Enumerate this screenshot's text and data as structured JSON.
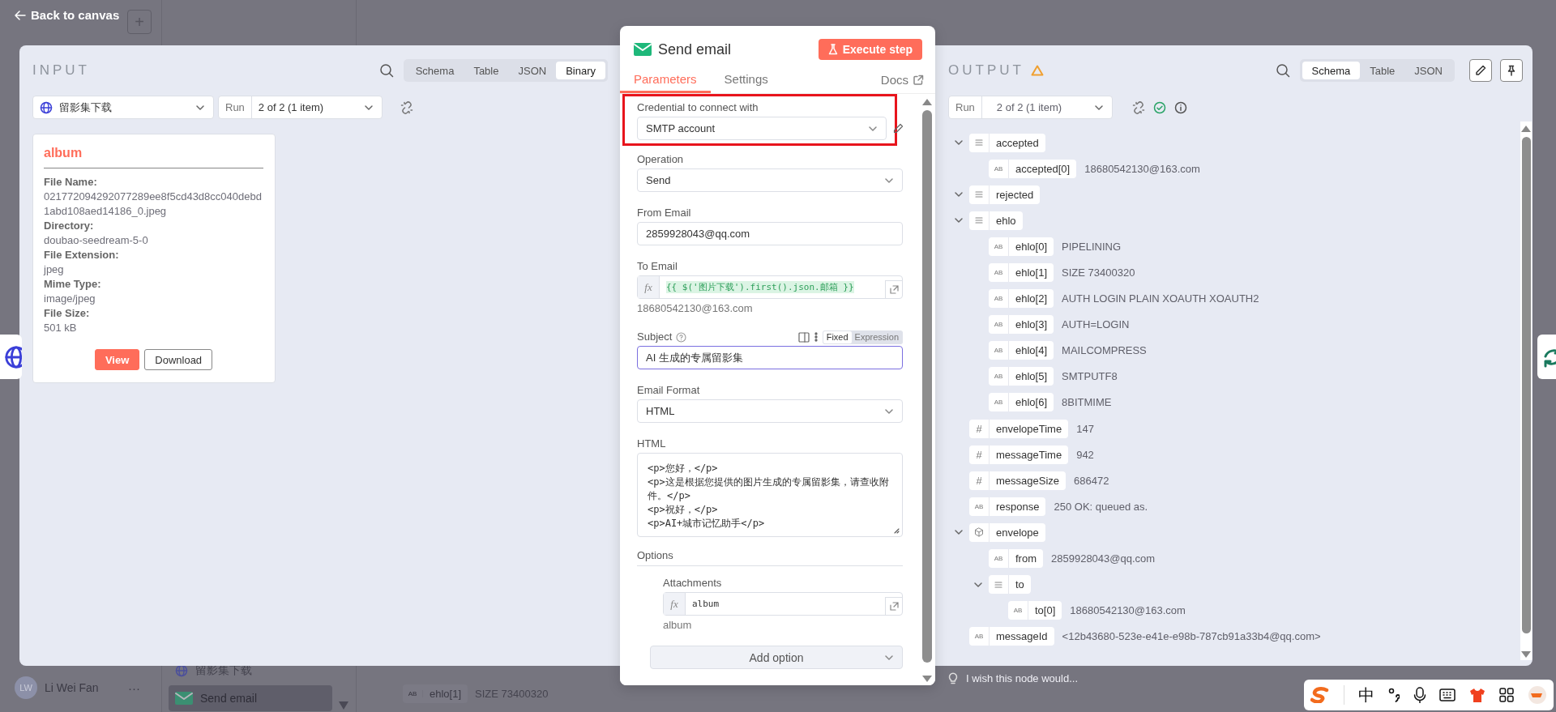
{
  "backdrop": {
    "new_button": "+",
    "user": {
      "initials": "LW",
      "name": "Li Wei Fan",
      "menu": "···"
    },
    "nodes": [
      {
        "label": "留影集下载",
        "kind": "http",
        "selected": false
      },
      {
        "label": "Send email",
        "kind": "email",
        "selected": true
      }
    ],
    "rows": [
      {
        "key": "ehlo[1]",
        "badge": "AB",
        "value": "SIZE 73400320"
      }
    ]
  },
  "back_link": "Back to canvas",
  "input": {
    "title": "INPUT",
    "views": [
      {
        "label": "Schema",
        "selected": false
      },
      {
        "label": "Table",
        "selected": false
      },
      {
        "label": "JSON",
        "selected": false
      },
      {
        "label": "Binary",
        "selected": true
      }
    ],
    "node_select": "留影集下载",
    "run_label": "Run",
    "run_select": "2 of 2 (1 item)",
    "binary": {
      "name": "album",
      "fields": [
        {
          "label": "File Name:",
          "value": "021772094292077289ee8f5cd43d8cc040debd1abd108aed14186_0.jpeg"
        },
        {
          "label": "Directory:",
          "value": "doubao-seedream-5-0"
        },
        {
          "label": "File Extension:",
          "value": "jpeg"
        },
        {
          "label": "Mime Type:",
          "value": "image/jpeg"
        },
        {
          "label": "File Size:",
          "value": "501 kB"
        }
      ],
      "buttons": [
        {
          "label": "View",
          "kind": "primary"
        },
        {
          "label": "Download",
          "kind": "secondary"
        }
      ]
    }
  },
  "node": {
    "title": "Send email",
    "execute": "Execute step",
    "tabs": [
      {
        "label": "Parameters",
        "selected": true
      },
      {
        "label": "Settings",
        "selected": false
      }
    ],
    "docs": "Docs",
    "fields": [
      {
        "kind": "select",
        "label": "Credential to connect with",
        "value": "SMTP account",
        "highlighted": true,
        "focused": false
      },
      {
        "kind": "select",
        "label": "Operation",
        "value": "Send",
        "highlighted": false,
        "focused": false
      },
      {
        "kind": "input",
        "label": "From Email",
        "value": "2859928043@qq.com",
        "highlighted": false,
        "focused": false
      },
      {
        "kind": "expression",
        "label": "To Email",
        "prefix": "fx",
        "value": "{{ $('图片下载').first().json.邮箱 }}",
        "result": "18680542130@163.com",
        "highlighted": false,
        "focused": false
      },
      {
        "kind": "input",
        "label": "Subject",
        "help": true,
        "modes": [
          {
            "label": "Fixed",
            "selected": true
          },
          {
            "label": "Expression",
            "selected": false
          }
        ],
        "value": "AI 生成的专属留影集",
        "highlighted": false,
        "focused": true
      },
      {
        "kind": "select",
        "label": "Email Format",
        "value": "HTML",
        "highlighted": false,
        "focused": false
      },
      {
        "kind": "code",
        "label": "HTML",
        "value": "<p>您好，</p>\n<p>这是根据您提供的图片生成的专属留影集，请查收附件。</p>\n<p>祝好，</p>\n<p>AI+城市记忆助手</p>",
        "highlighted": false,
        "focused": false
      }
    ],
    "options": {
      "title": "Options",
      "items": [
        {
          "kind": "expression",
          "label": "Attachments",
          "prefix": "fx",
          "value": "album",
          "result": "album"
        }
      ],
      "add": "Add option"
    }
  },
  "output": {
    "title": "OUTPUT",
    "warning": true,
    "views": [
      {
        "label": "Schema",
        "selected": true
      },
      {
        "label": "Table",
        "selected": false
      },
      {
        "label": "JSON",
        "selected": false
      }
    ],
    "run_label": "Run",
    "run_select": "2 of 2 (1 item)",
    "tree": [
      {
        "key": "accepted",
        "kind": "array",
        "expanded": true,
        "children": [
          {
            "key": "accepted[0]",
            "kind": "string",
            "badge": "AB",
            "value": "18680542130@163.com"
          }
        ]
      },
      {
        "key": "rejected",
        "kind": "array",
        "expanded": true
      },
      {
        "key": "ehlo",
        "kind": "array",
        "expanded": true,
        "children": [
          {
            "key": "ehlo[0]",
            "kind": "string",
            "badge": "AB",
            "value": "PIPELINING"
          },
          {
            "key": "ehlo[1]",
            "kind": "string",
            "badge": "AB",
            "value": "SIZE 73400320"
          },
          {
            "key": "ehlo[2]",
            "kind": "string",
            "badge": "AB",
            "value": "AUTH LOGIN PLAIN XOAUTH XOAUTH2"
          },
          {
            "key": "ehlo[3]",
            "kind": "string",
            "badge": "AB",
            "value": "AUTH=LOGIN"
          },
          {
            "key": "ehlo[4]",
            "kind": "string",
            "badge": "AB",
            "value": "MAILCOMPRESS"
          },
          {
            "key": "ehlo[5]",
            "kind": "string",
            "badge": "AB",
            "value": "SMTPUTF8"
          },
          {
            "key": "ehlo[6]",
            "kind": "string",
            "badge": "AB",
            "value": "8BITMIME"
          }
        ]
      },
      {
        "key": "envelopeTime",
        "kind": "number",
        "badge": "#",
        "value": "147"
      },
      {
        "key": "messageTime",
        "kind": "number",
        "badge": "#",
        "value": "942"
      },
      {
        "key": "messageSize",
        "kind": "number",
        "badge": "#",
        "value": "686472"
      },
      {
        "key": "response",
        "kind": "string",
        "badge": "AB",
        "value": "250 OK: queued as."
      },
      {
        "key": "envelope",
        "kind": "object",
        "expanded": true,
        "children": [
          {
            "key": "from",
            "kind": "string",
            "badge": "AB",
            "value": "2859928043@qq.com"
          },
          {
            "key": "to",
            "kind": "array",
            "expanded": true,
            "children": [
              {
                "key": "to[0]",
                "kind": "string",
                "badge": "AB",
                "value": "18680542130@163.com"
              }
            ]
          }
        ]
      },
      {
        "key": "messageId",
        "kind": "string",
        "badge": "AB",
        "value": "<12b43680-523e-e41e-e98b-787cb91a33b4@qq.com>"
      }
    ]
  },
  "feedback": "I wish this node would...",
  "ime": {
    "mode": "中"
  }
}
